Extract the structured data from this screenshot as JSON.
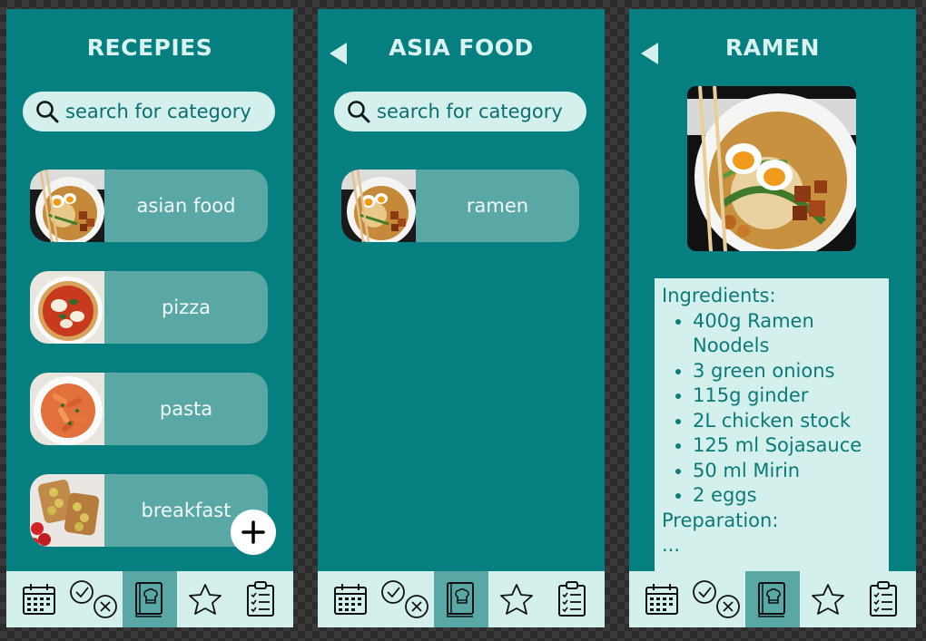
{
  "screens": [
    {
      "title": "RECEPIES",
      "search_placeholder": "search for category",
      "items": [
        "asian food",
        "pizza",
        "pasta",
        "breakfast"
      ]
    },
    {
      "title": "ASIA FOOD",
      "search_placeholder": "search for category",
      "items": [
        "ramen"
      ]
    },
    {
      "title": "RAMEN",
      "recipe": {
        "ingredients_heading": "Ingredients:",
        "ingredients": [
          "400g Ramen Noodels",
          "3 green onions",
          "115g ginder",
          "2L chicken stock",
          "125 ml Sojasauce",
          "50 ml Mirin",
          "2 eggs"
        ],
        "preparation_heading": "Preparation:",
        "preparation_text": "..."
      }
    }
  ],
  "tabbar": {
    "tabs": [
      "calendar-icon",
      "check-cross-icon",
      "recipe-book-icon",
      "star-icon",
      "checklist-icon"
    ],
    "active_index": 2
  },
  "colors": {
    "screen_bg": "#057f7f",
    "light": "#d4f0ec",
    "card": "#5aa8a5",
    "text_dark": "#0b6e70"
  }
}
